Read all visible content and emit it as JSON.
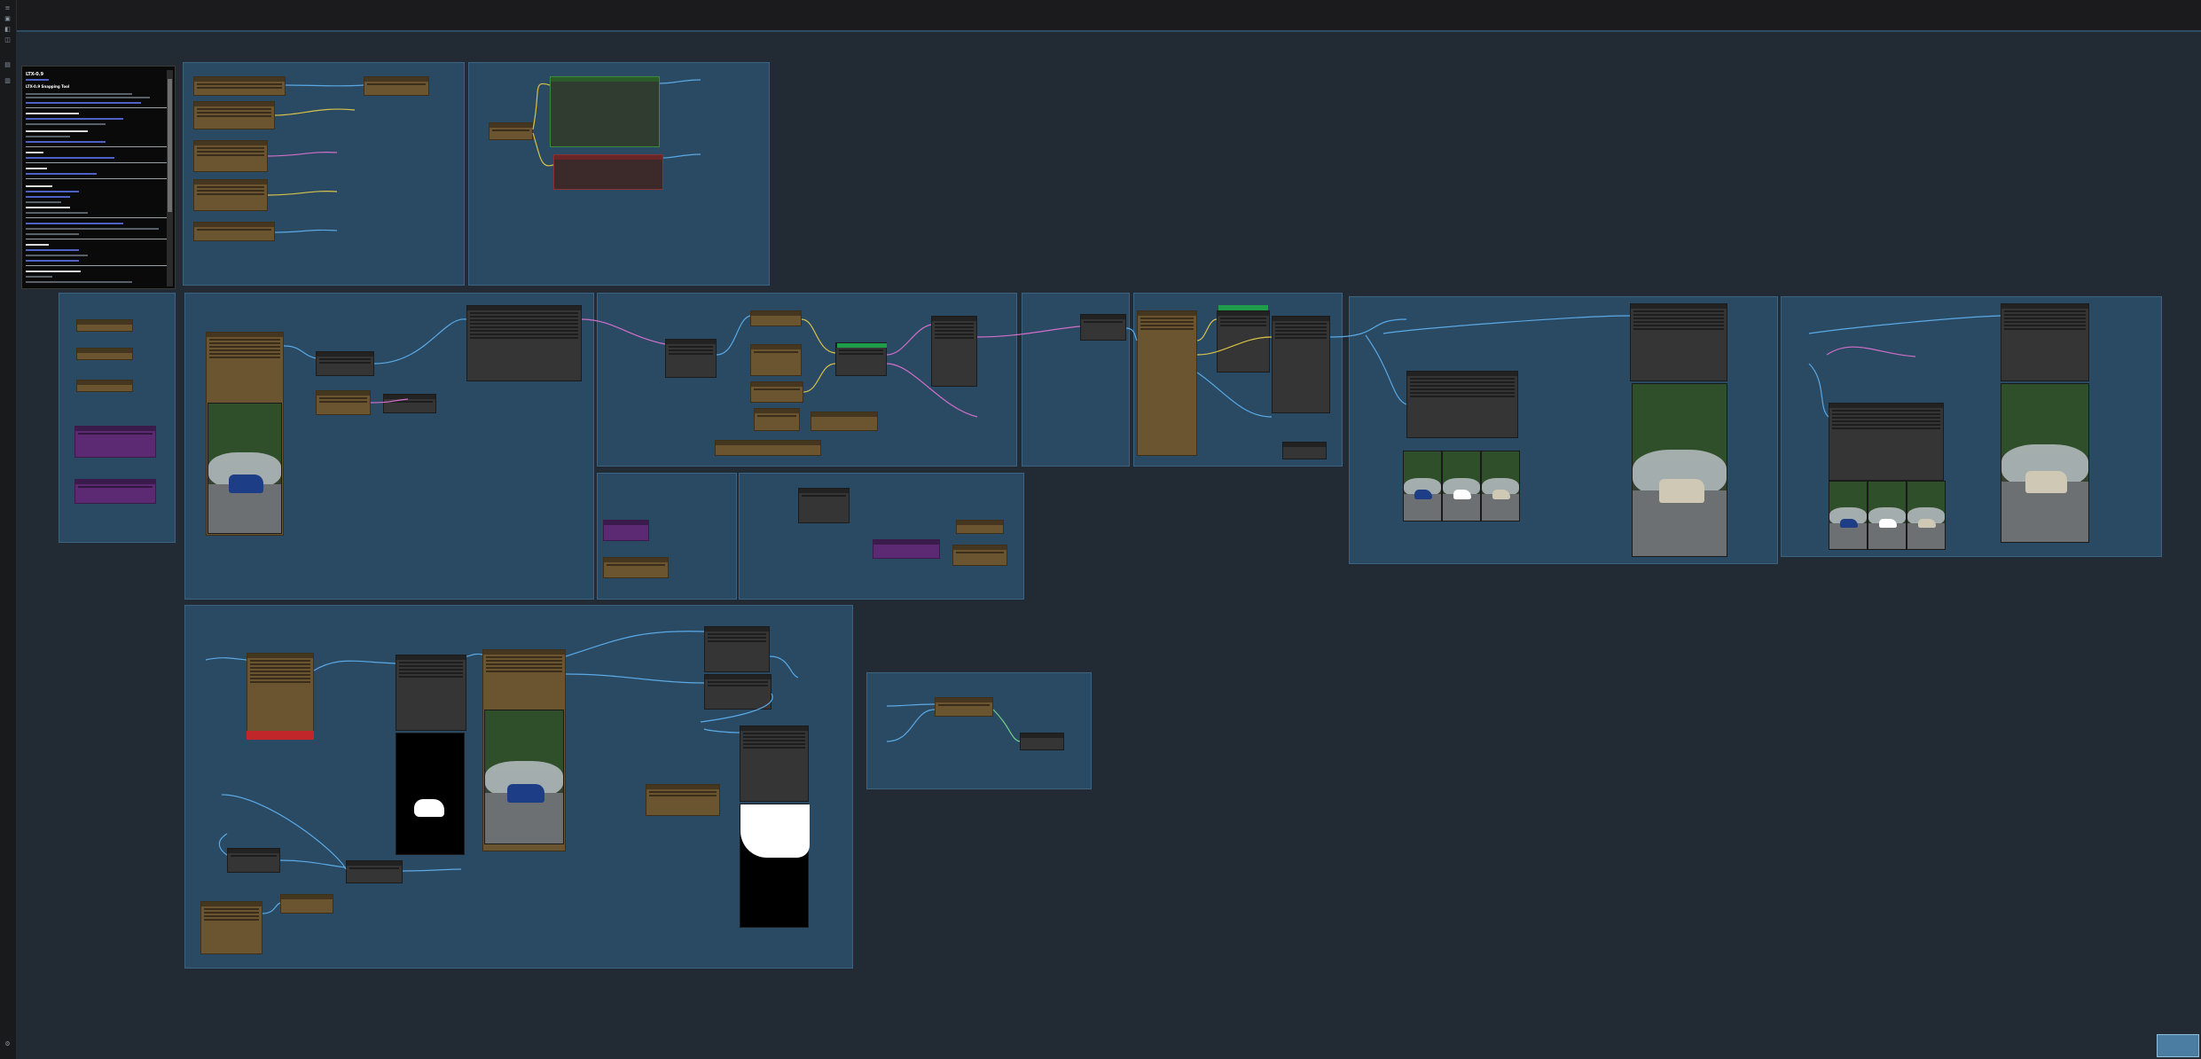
{
  "app": {
    "accent": "#2d4d63",
    "canvas_bg": "#222a33",
    "group_bg": "#2a4a63"
  },
  "sidebar": {
    "icons": [
      "queue-icon",
      "node-library-icon",
      "model-library-icon",
      "workflows-icon",
      "templates-icon",
      "settings-icon"
    ]
  },
  "note": {
    "title": "LTX-0.9",
    "subtitle": "LTX-0.9 Snapping Tool",
    "heading_models": "Required LTX 0.9 Models",
    "heading_custom": "Required Custom nodes",
    "heading_license": "Model/Checkpoint Directories"
  },
  "minimap": {
    "label": ""
  },
  "colors": {
    "node_brown": "#6b5531",
    "node_gray": "#3a3a3a",
    "node_purple": "#5b2a73",
    "wire_blue": "#5aa9e6",
    "wire_pink": "#d16ec9",
    "wire_yellow": "#d8c24a",
    "success": "#1f9d4b",
    "error": "#c0262a"
  }
}
